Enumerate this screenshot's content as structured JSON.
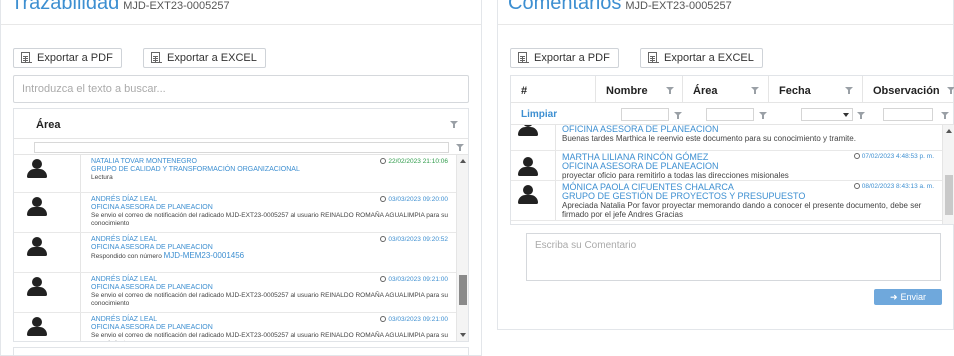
{
  "left": {
    "title": "Trazabilidad",
    "code": "MJD-EXT23-0005257",
    "export_pdf": "Exportar a PDF",
    "export_excel": "Exportar a EXCEL",
    "search_placeholder": "Introduzca el texto a buscar...",
    "area_label": "Área",
    "items": [
      {
        "name": "NATALIA TOVAR MONTENEGRO",
        "org": "GRUPO DE CALIDAD Y TRANSFORMACIÓN ORGANIZACIONAL",
        "text": "Lectura",
        "date": "22/02/2023 21:10:06"
      },
      {
        "name": "ANDRÉS DÍAZ LEAL",
        "org": "OFICINA ASESORA DE PLANEACION",
        "text": "Se envio el correo de notificación del radicado MJD-EXT23-0005257 al usuario REINALDO ROMAÑA AGUALIMPIA para su conocimiento",
        "date": "03/03/2023 09:20:00"
      },
      {
        "name": "ANDRÉS DÍAZ LEAL",
        "org": "OFICINA ASESORA DE PLANEACION",
        "text": "Respondido con número",
        "link": "MJD-MEM23-0001456",
        "date": "03/03/2023 09:20:52"
      },
      {
        "name": "ANDRÉS DÍAZ LEAL",
        "org": "OFICINA ASESORA DE PLANEACION",
        "text": "Se envio el correo de notificación del radicado MJD-EXT23-0005257 al usuario REINALDO ROMAÑA AGUALIMPIA para su conocimiento",
        "date": "03/03/2023 09:21:00"
      },
      {
        "name": "ANDRÉS DÍAZ LEAL",
        "org": "OFICINA ASESORA DE PLANEACION",
        "text": "Se envio el correo de notificación del radicado MJD-EXT23-0005257 al usuario REINALDO ROMAÑA AGUALIMPIA para su conocimiento",
        "date": "03/03/2023 09:21:00"
      }
    ]
  },
  "right": {
    "title": "Comentarios",
    "code": "MJD-EXT23-0005257",
    "export_pdf": "Exportar a PDF",
    "export_excel": "Exportar a EXCEL",
    "columns": [
      "#",
      "Nombre",
      "Área",
      "Fecha",
      "Observación"
    ],
    "clear_label": "Limpiar",
    "comments": [
      {
        "name": "",
        "org": "OFICINA ASESORA DE PLANEACION",
        "text": "Buenas tardes Marthica le reenvio este documento para su conocimiento y tramite.",
        "date": ""
      },
      {
        "name": "MARTHA LILIANA RINCÓN GÓMEZ",
        "org": "OFICINA ASESORA DE PLANEACION",
        "text": "proyectar oficio para remitirlo a todas las direcciones misionales",
        "date": "07/02/2023 4:48:53 p. m."
      },
      {
        "name": "MÓNICA PAOLA CIFUENTES CHALARCA",
        "org": "GRUPO DE GESTIÓN DE PROYECTOS Y PRESUPUESTO",
        "text": "Apreciada Natalia Por favor proyectar memorando dando a conocer el presente documento, debe ser firmado por el jefe Andres Gracias",
        "date": "08/02/2023 8:43:13 a. m."
      }
    ],
    "comment_placeholder": "Escriba su Comentario",
    "send_label": "Enviar"
  }
}
